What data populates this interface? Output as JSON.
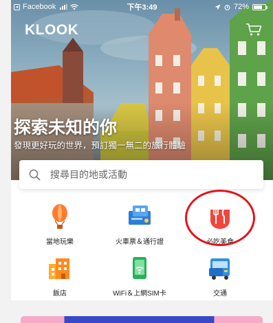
{
  "status_bar": {
    "back_app": "Facebook",
    "time": "下午3:49",
    "battery": "72%",
    "battery_level": 0.72
  },
  "header": {
    "logo": "KLOOK"
  },
  "hero": {
    "title": "探索未知的你",
    "subtitle": "發現更好玩的世界，預訂獨一無二的旅行體驗"
  },
  "search": {
    "placeholder": "搜尋目的地或活動"
  },
  "categories": [
    {
      "label": "當地玩樂",
      "icon": "hot-air-balloon-icon"
    },
    {
      "label": "火車票＆通行證",
      "icon": "train-ticket-icon"
    },
    {
      "label": "必吃美食",
      "icon": "food-utensils-icon"
    },
    {
      "label": "飯店",
      "icon": "hotel-icon"
    },
    {
      "label": "WiFi＆上網SIM卡",
      "icon": "wifi-sim-icon"
    },
    {
      "label": "交通",
      "icon": "transport-bus-icon"
    }
  ],
  "colors": {
    "accent_orange": "#ff5722",
    "highlight_ring": "#e3131c",
    "food_icon_red": "#f0463c",
    "panel_bg": "#ffffff",
    "page_bg": "#f2f2f2"
  }
}
